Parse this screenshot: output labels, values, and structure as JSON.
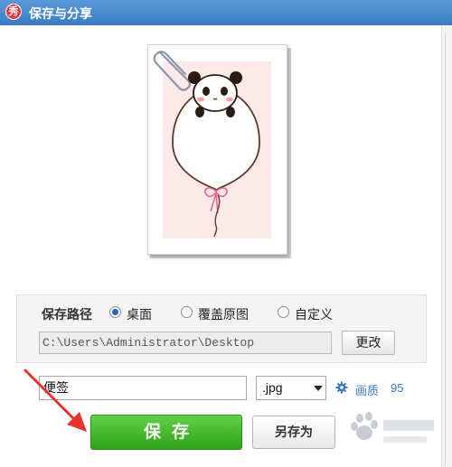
{
  "window": {
    "title": "保存与分享",
    "logo_glyph": "秀"
  },
  "save_path": {
    "label": "保存路径",
    "options": [
      {
        "label": "桌面",
        "checked": true
      },
      {
        "label": "覆盖原图",
        "checked": false
      },
      {
        "label": "自定义",
        "checked": false
      }
    ],
    "path_value": "C:\\Users\\Administrator\\Desktop",
    "change_button": "更改"
  },
  "file": {
    "name_value": "便签",
    "extension": ".jpg",
    "quality_label": "画质",
    "quality_value": "95"
  },
  "actions": {
    "save": "保存",
    "save_as": "另存为"
  },
  "colors": {
    "titlebar": "#3a7cc4",
    "save_button": "#3cb62a",
    "accent_link": "#3a7cc4",
    "annotation_arrow": "#e8332a"
  }
}
